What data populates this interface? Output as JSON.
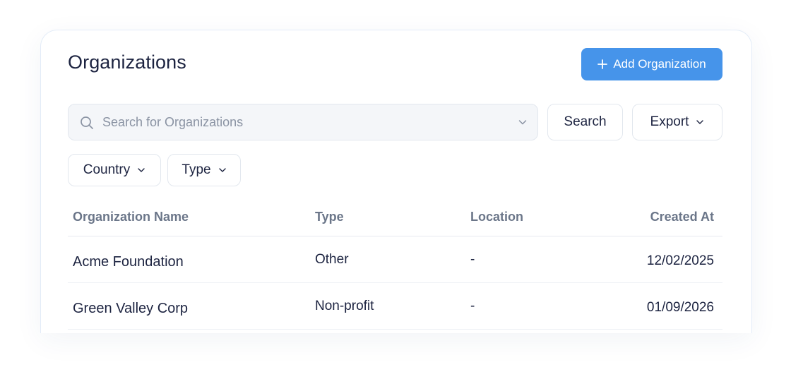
{
  "header": {
    "title": "Organizations",
    "add_button_label": "Add Organization"
  },
  "search": {
    "placeholder": "Search for Organizations",
    "value": "",
    "button_label": "Search"
  },
  "export": {
    "label": "Export"
  },
  "filters": [
    {
      "label": "Country"
    },
    {
      "label": "Type"
    }
  ],
  "table": {
    "columns": [
      "Organization Name",
      "Type",
      "Location",
      "Created At"
    ],
    "rows": [
      {
        "name": "Acme Foundation",
        "type": "Other",
        "location": "-",
        "created_at": "12/02/2025"
      },
      {
        "name": "Green Valley Corp",
        "type": "Non-profit",
        "location": "-",
        "created_at": "01/09/2026"
      }
    ]
  },
  "colors": {
    "accent": "#4694ea",
    "text": "#1c2340",
    "muted": "#6b7689"
  },
  "icons": {
    "add": "plus-icon",
    "search": "search-icon",
    "dropdown": "chevron-down-icon"
  }
}
